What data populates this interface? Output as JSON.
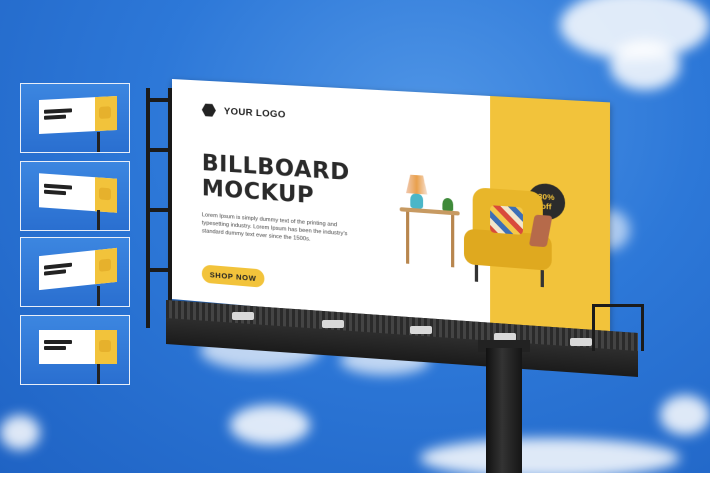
{
  "billboard": {
    "logo_text": "YOUR LOGO",
    "headline_line1": "BILLBOARD",
    "headline_line2": "MOCKUP",
    "body_copy": "Lorem Ipsum is simply dummy text of the printing and typesetting industry. Lorem Ipsum has been the industry's standard dummy text ever since the 1500s.",
    "cta_label": "SHOP NOW",
    "badge_line1": "30%",
    "badge_line2": "off",
    "accent_color": "#f2c33b",
    "text_color": "#2a2a2a"
  },
  "thumbnails": [
    {
      "name": "thumbnail-1"
    },
    {
      "name": "thumbnail-2"
    },
    {
      "name": "thumbnail-3"
    },
    {
      "name": "thumbnail-4"
    }
  ],
  "colors": {
    "sky": "#2d78d8",
    "accent": "#f2c33b",
    "structure": "#1b1b1b"
  }
}
